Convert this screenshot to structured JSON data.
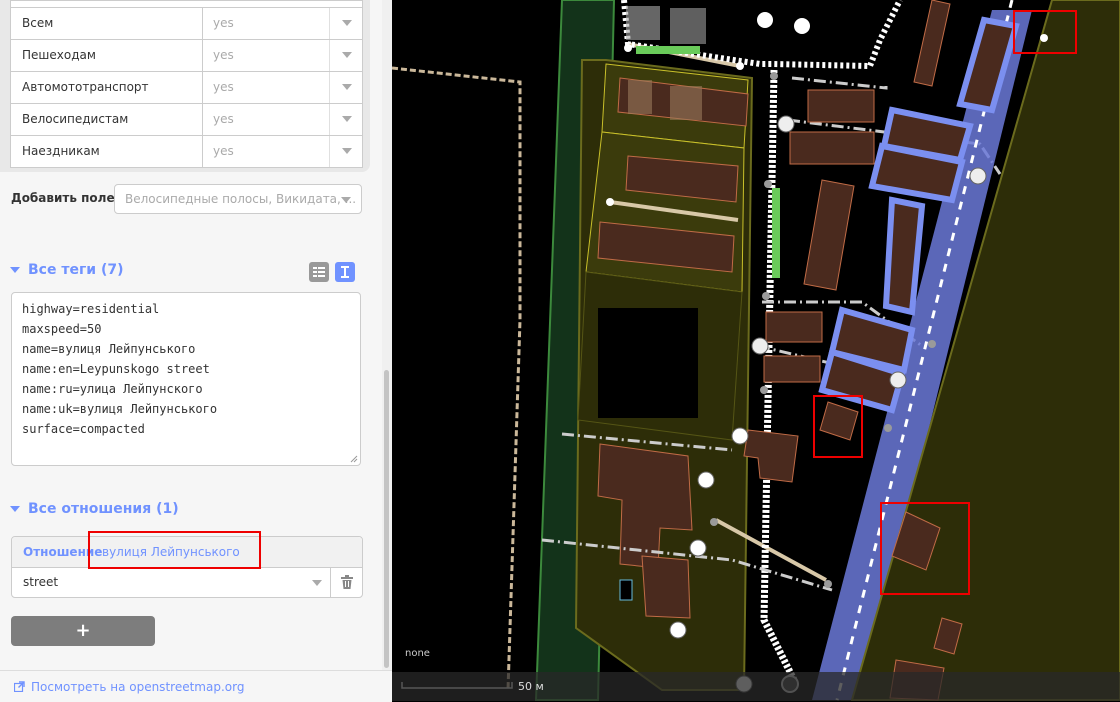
{
  "access": {
    "rows": [
      {
        "label": "Всем",
        "value": "yes"
      },
      {
        "label": "Пешеходам",
        "value": "yes"
      },
      {
        "label": "Автомототранспорт",
        "value": "yes"
      },
      {
        "label": "Велосипедистам",
        "value": "yes"
      },
      {
        "label": "Наездникам",
        "value": "yes"
      }
    ]
  },
  "add_field": {
    "label": "Добавить поле:",
    "placeholder": "Велосипедные полосы, Викидата, ..."
  },
  "tags_section": {
    "title": "Все теги (7)",
    "lines": [
      "highway=residential",
      "maxspeed=50",
      "name=вулиця Лейпунського",
      "name:en=Leypunskogo street",
      "name:ru=улица Лейпунского",
      "name:uk=вулиця Лейпунського",
      "surface=compacted"
    ]
  },
  "relations_section": {
    "title": "Все отношения (1)",
    "relation_label": "Отношение",
    "relation_name": "вулиця Лейпунського",
    "role": "street",
    "add_label": "+"
  },
  "footer": {
    "link": "Посмотреть на openstreetmap.org"
  },
  "map": {
    "scale_label": "50 м",
    "imagery_label": "none"
  },
  "colors": {
    "accent": "#7092ff",
    "highlight": "#e00000"
  }
}
